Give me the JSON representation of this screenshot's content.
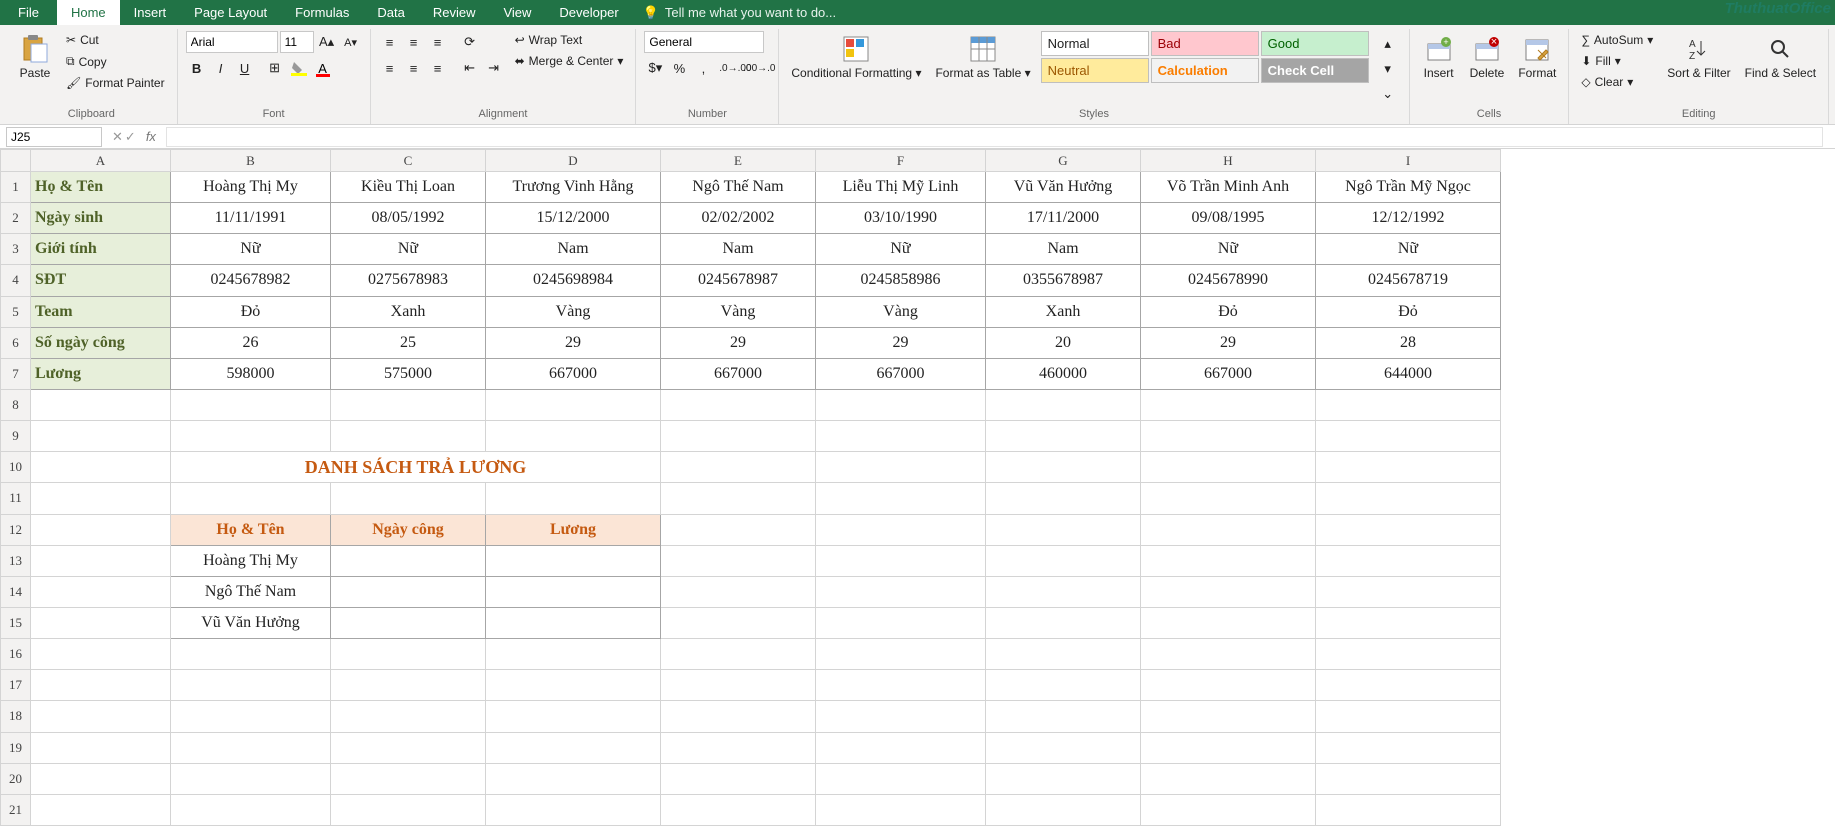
{
  "tabs": {
    "file": "File",
    "home": "Home",
    "insert": "Insert",
    "page_layout": "Page Layout",
    "formulas": "Formulas",
    "data": "Data",
    "review": "Review",
    "view": "View",
    "developer": "Developer",
    "tell": "Tell me what you want to do..."
  },
  "ribbon": {
    "clipboard": {
      "label": "Clipboard",
      "paste": "Paste",
      "cut": "Cut",
      "copy": "Copy",
      "format_painter": "Format Painter"
    },
    "font": {
      "label": "Font",
      "name": "Arial",
      "size": "11"
    },
    "alignment": {
      "label": "Alignment",
      "wrap": "Wrap Text",
      "merge": "Merge & Center"
    },
    "number": {
      "label": "Number",
      "format": "General"
    },
    "styles": {
      "label": "Styles",
      "cond": "Conditional Formatting",
      "fat": "Format as Table",
      "cells": {
        "normal": "Normal",
        "bad": "Bad",
        "good": "Good",
        "neutral": "Neutral",
        "calc": "Calculation",
        "check": "Check Cell"
      }
    },
    "cells": {
      "label": "Cells",
      "insert": "Insert",
      "delete": "Delete",
      "format": "Format"
    },
    "editing": {
      "label": "Editing",
      "autosum": "AutoSum",
      "fill": "Fill",
      "clear": "Clear",
      "sort": "Sort & Filter",
      "find": "Find & Select"
    }
  },
  "namebox": "J25",
  "columns": [
    "A",
    "B",
    "C",
    "D",
    "E",
    "F",
    "G",
    "H",
    "I"
  ],
  "rowlabels": [
    "Họ & Tên",
    "Ngày sinh",
    "Giới tính",
    "SĐT",
    "Team",
    "Số ngày công",
    "Lương"
  ],
  "data": {
    "B": [
      "Hoàng Thị My",
      "11/11/1991",
      "Nữ",
      "0245678982",
      "Đỏ",
      "26",
      "598000"
    ],
    "C": [
      "Kiều Thị Loan",
      "08/05/1992",
      "Nữ",
      "0275678983",
      "Xanh",
      "25",
      "575000"
    ],
    "D": [
      "Trương Vinh Hằng",
      "15/12/2000",
      "Nam",
      "0245698984",
      "Vàng",
      "29",
      "667000"
    ],
    "E": [
      "Ngô Thế Nam",
      "02/02/2002",
      "Nam",
      "0245678987",
      "Vàng",
      "29",
      "667000"
    ],
    "F": [
      "Liễu Thị Mỹ Linh",
      "03/10/1990",
      "Nữ",
      "0245858986",
      "Vàng",
      "29",
      "667000"
    ],
    "G": [
      "Vũ Văn Hưởng",
      "17/11/2000",
      "Nam",
      "0355678987",
      "Xanh",
      "20",
      "460000"
    ],
    "H": [
      "Võ Trần Minh Anh",
      "09/08/1995",
      "Nữ",
      "0245678990",
      "Đỏ",
      "29",
      "667000"
    ],
    "I": [
      "Ngô Trần Mỹ Ngọc",
      "12/12/1992",
      "Nữ",
      "0245678719",
      "Đỏ",
      "28",
      "644000"
    ]
  },
  "title2": "DANH SÁCH TRẢ LƯƠNG",
  "table2": {
    "headers": [
      "Họ & Tên",
      "Ngày công",
      "Lương"
    ],
    "rows": [
      [
        "Hoàng Thị My",
        "",
        ""
      ],
      [
        "Ngô Thế Nam",
        "",
        ""
      ],
      [
        "Vũ Văn Hưởng",
        "",
        ""
      ]
    ]
  },
  "watermark": "ThuthuatOffice"
}
